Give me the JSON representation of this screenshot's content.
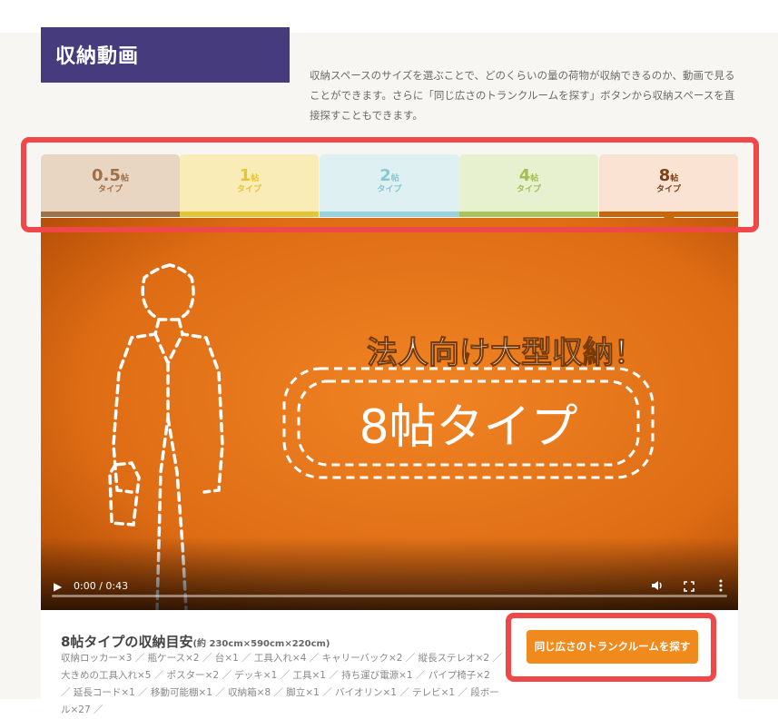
{
  "section": {
    "title": "収納動画",
    "description": "収納スペースのサイズを選ぶことで、どのくらいの量の荷物が収納できるのか、動画で見ることができます。さらに「同じ広さのトランクルームを探す」ボタンから収納スペースを直接探すこともできます。"
  },
  "tabs": [
    {
      "num": "0.5",
      "unit": "帖",
      "type": "タイプ",
      "bg": "#e9d6c2",
      "bar": "#a07048",
      "text": "#a07048",
      "active": false
    },
    {
      "num": "1",
      "unit": "帖",
      "type": "タイプ",
      "bg": "#f9ecb6",
      "bar": "#e5c534",
      "text": "#e5c534",
      "active": false
    },
    {
      "num": "2",
      "unit": "帖",
      "type": "タイプ",
      "bg": "#dff0f2",
      "bar": "#97d2dd",
      "text": "#86c7d3",
      "active": false
    },
    {
      "num": "4",
      "unit": "帖",
      "type": "タイプ",
      "bg": "#e8f1cf",
      "bar": "#a9c45a",
      "text": "#a2be52",
      "active": false
    },
    {
      "num": "8",
      "unit": "帖",
      "type": "タイプ",
      "bg": "#fae3d3",
      "bar": "#c8660c",
      "text": "#7a4018",
      "active": true
    }
  ],
  "video": {
    "headline": "法人向け大型収納！",
    "badge": "8帖タイプ",
    "time": "0:00 / 0:43",
    "play_icon": "play-icon",
    "volume_icon": "volume-icon",
    "fullscreen_icon": "fullscreen-icon",
    "more_icon": "more-vert-icon"
  },
  "info": {
    "title": "8帖タイプの収納目安",
    "size": "(約 230cm×590cm×220cm)",
    "items": "収納ロッカー×3 ／ 瓶ケース×2 ／ 台×1 ／ 工具入れ×4 ／ キャリーバック×2 ／ 縦長ステレオ×2 ／ 大きめの工具入れ×5 ／ ポスター×2 ／ デッキ×1 ／ 工具×1 ／ 持ち運び電源×1 ／ パイプ椅子×2 ／ 延長コード×1 ／ 移動可能棚×1 ／ 収納箱×8 ／ 脚立×1 ／ バイオリン×1 ／ テレビ×1 ／ 段ボール×27 ／",
    "cta": "同じ広さのトランクルームを探す"
  },
  "colors": {
    "title_bg": "#453b7d",
    "video_bg": "#e07218",
    "cta_bg": "#f08a1c",
    "highlight": "#f04848"
  }
}
